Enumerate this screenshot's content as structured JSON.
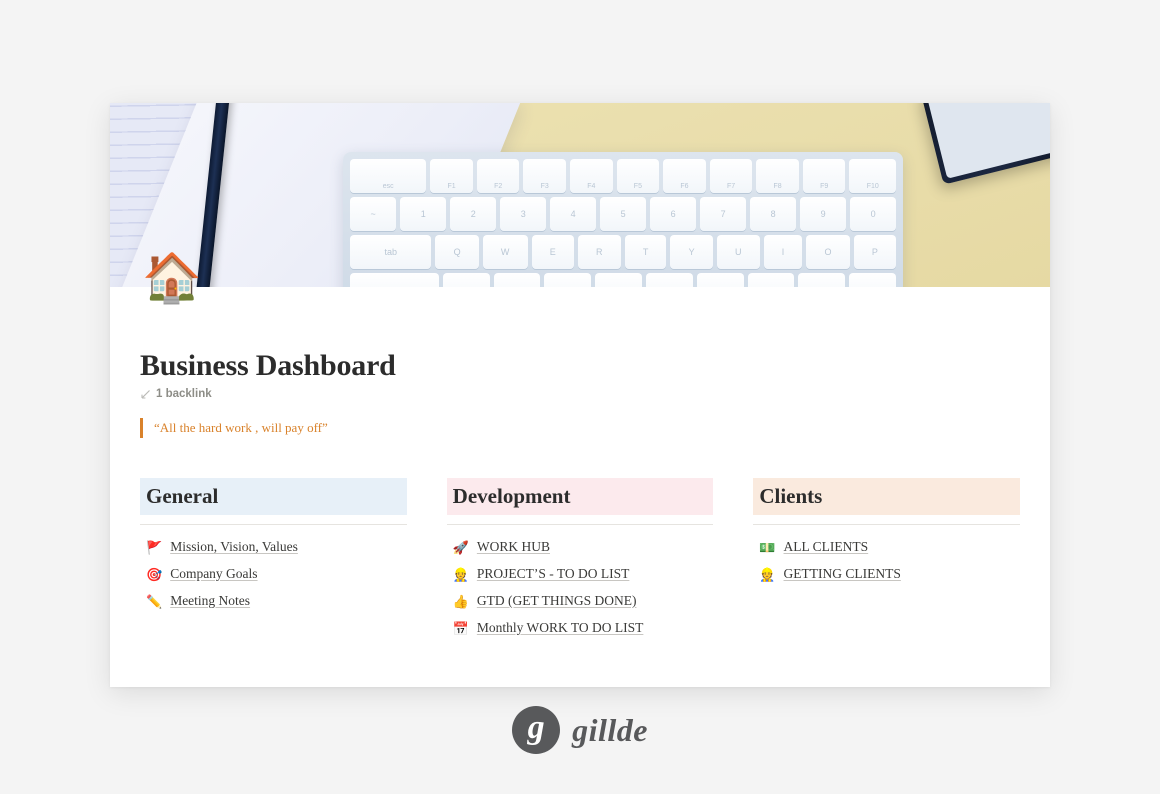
{
  "theme": {
    "background": "#f4f4f4",
    "card_background": "#ffffff",
    "accent_orange": "#d9822b",
    "text_dark": "#2c2c2c",
    "muted_text": "#8d8d87",
    "divider": "#e6e4e0",
    "logo_gray": "#58595b"
  },
  "document": {
    "page_icon": "🏠",
    "page_icon_name": "house-emoji",
    "title": "Business Dashboard",
    "backlink": {
      "icon": "backlink-arrow-icon",
      "label": "1 backlink"
    },
    "quote": "“All the hard work , will pay off”"
  },
  "columns": [
    {
      "id": "general",
      "heading": "General",
      "highlight_color": "#e7f0f8",
      "links": [
        {
          "emoji": "🚩",
          "icon_name": "triangular-flag-icon",
          "label": "Mission, Vision, Values"
        },
        {
          "emoji": "🎯",
          "icon_name": "dart-target-icon",
          "label": "Company Goals"
        },
        {
          "emoji": "✏️",
          "icon_name": "pencil-icon",
          "label": "Meeting Notes"
        }
      ]
    },
    {
      "id": "development",
      "heading": "Development",
      "highlight_color": "#fceaed",
      "links": [
        {
          "emoji": "🚀",
          "icon_name": "rocket-icon",
          "label": "WORK HUB"
        },
        {
          "emoji": "👷",
          "icon_name": "construction-worker-icon",
          "label": "PROJECT’S - TO DO LIST"
        },
        {
          "emoji": "👍",
          "icon_name": "thumbs-up-icon",
          "label": "GTD (GET THINGS DONE)"
        },
        {
          "emoji": "📅",
          "icon_name": "calendar-icon",
          "label": "Monthly WORK TO DO LIST"
        }
      ]
    },
    {
      "id": "clients",
      "heading": "Clients",
      "highlight_color": "#faeade",
      "links": [
        {
          "emoji": "💵",
          "icon_name": "banknote-icon",
          "label": "ALL CLIENTS"
        },
        {
          "emoji": "👷",
          "icon_name": "construction-worker-icon",
          "label": "GETTING CLIENTS"
        }
      ]
    }
  ],
  "footer": {
    "logo_letter": "g",
    "logo_word": "gillde"
  },
  "cover": {
    "alt": "Notebook with lined paper, dark pen and white keyboard on yellow desk",
    "keyboard_rows": [
      [
        "esc",
        "F1",
        "F2",
        "F3",
        "F4",
        "F5",
        "F6",
        "F7",
        "F8",
        "F9",
        "F10"
      ],
      [
        "~",
        "1",
        "2",
        "3",
        "4",
        "5",
        "6",
        "7",
        "8",
        "9",
        "0"
      ],
      [
        "tab",
        "Q",
        "W",
        "E",
        "R",
        "T",
        "Y",
        "U",
        "I",
        "O",
        "P"
      ]
    ]
  }
}
